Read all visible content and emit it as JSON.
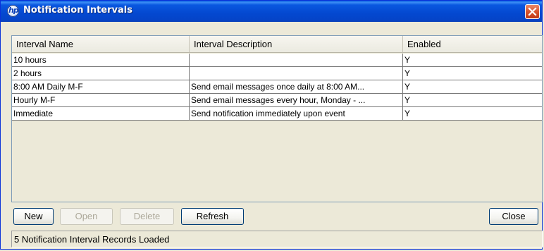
{
  "window": {
    "title": "Notification Intervals"
  },
  "table": {
    "columns": [
      "Interval Name",
      "Interval Description",
      "Enabled"
    ],
    "rows": [
      {
        "name": "10 hours",
        "description": "",
        "enabled": "Y"
      },
      {
        "name": "2 hours",
        "description": "",
        "enabled": "Y"
      },
      {
        "name": "8:00 AM Daily M-F",
        "description": "Send email messages once daily at 8:00 AM...",
        "enabled": "Y"
      },
      {
        "name": "Hourly M-F",
        "description": "Send email messages every hour, Monday - ...",
        "enabled": "Y"
      },
      {
        "name": "Immediate",
        "description": "Send notification immediately upon event",
        "enabled": "Y"
      }
    ]
  },
  "buttons": {
    "new": "New",
    "open": "Open",
    "delete": "Delete",
    "refresh": "Refresh",
    "close": "Close"
  },
  "status": "5 Notification Interval Records Loaded",
  "icons": {
    "app": "hp-logo-icon",
    "close": "close-icon"
  },
  "colors": {
    "titlebar": "#0a58e0",
    "close_button": "#d9542d",
    "window_bg": "#ece9d8"
  }
}
